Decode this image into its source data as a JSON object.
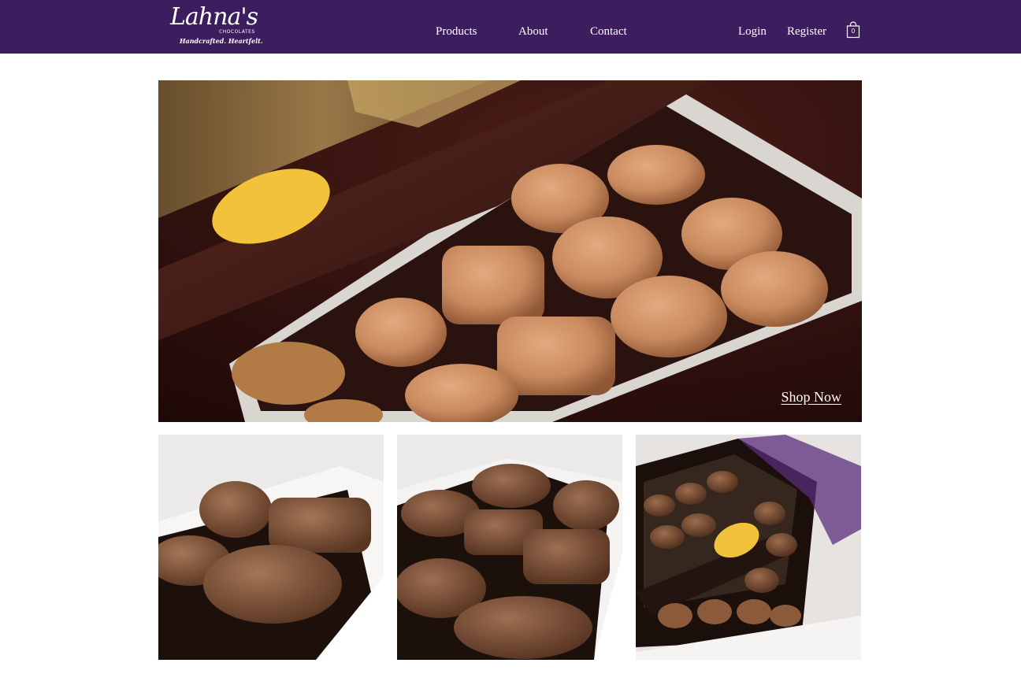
{
  "brand": {
    "logo_text": "Lahna's",
    "logo_subtext": "CHOCOLATES",
    "tagline": "Handcrafted. Heartfelt."
  },
  "nav": {
    "products": "Products",
    "about": "About",
    "contact": "Contact",
    "login": "Login",
    "register": "Register",
    "cart_count": "0"
  },
  "hero": {
    "cta": "Shop Now"
  },
  "colors": {
    "header_bg": "#3c1d5e",
    "text": "#ffffff"
  },
  "icons": {
    "cart": "shopping-bag-icon"
  }
}
